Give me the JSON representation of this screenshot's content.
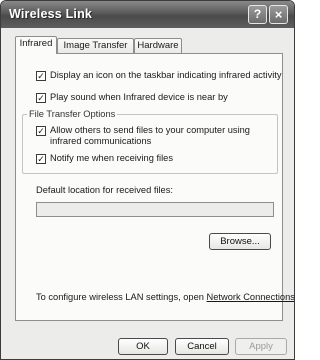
{
  "window": {
    "title": "Wireless Link",
    "help_glyph": "?",
    "close_glyph": "×"
  },
  "tabs": [
    {
      "label": "Infrared",
      "active": true
    },
    {
      "label": "Image Transfer",
      "active": false
    },
    {
      "label": "Hardware",
      "active": false
    }
  ],
  "options": {
    "taskbar_icon": {
      "label": "Display an icon on the taskbar indicating infrared activity",
      "checked": true
    },
    "play_sound": {
      "label": "Play sound when Infrared device is near by",
      "checked": true
    }
  },
  "file_transfer": {
    "group_title": "File Transfer Options",
    "allow_send": {
      "label": "Allow others to send files to your computer using infrared communications",
      "checked": true
    },
    "notify": {
      "label": "Notify me when receiving files",
      "checked": true
    }
  },
  "location": {
    "label": "Default location for received files:",
    "value": "",
    "browse_label": "Browse..."
  },
  "lan": {
    "text": "To configure wireless LAN settings, open ",
    "link": "Network Connections",
    "suffix": "."
  },
  "buttons": {
    "ok": "OK",
    "cancel": "Cancel",
    "apply": "Apply"
  },
  "checkmark_glyph": "✓"
}
